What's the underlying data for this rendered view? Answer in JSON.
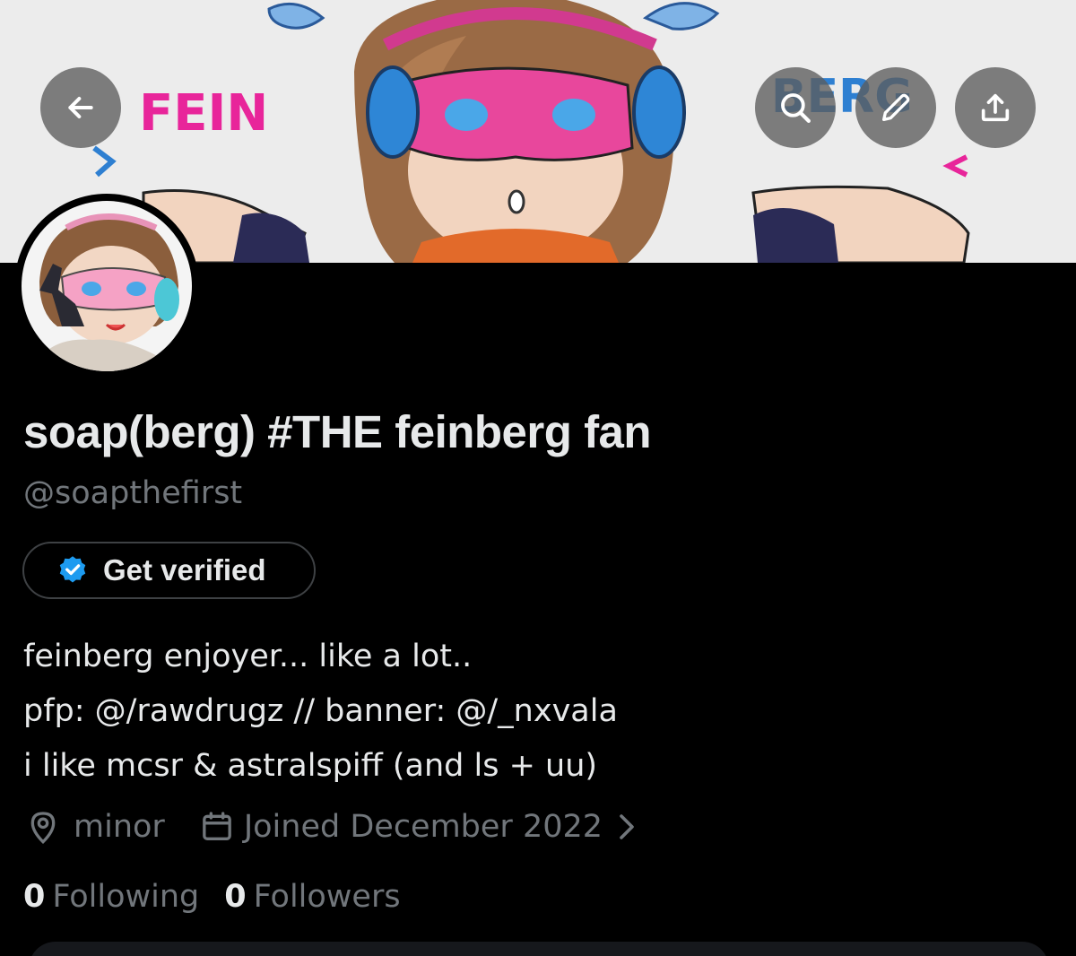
{
  "banner": {
    "description_icon": "banner-art",
    "art_text_left": "FEIN",
    "art_text_right": "BERG",
    "colors": {
      "pink": "#e8259a",
      "blue": "#2e7fd1",
      "brown": "#8b5a3c"
    }
  },
  "toolbar": {
    "back_icon": "arrow-left-icon",
    "search_icon": "search-icon",
    "edit_icon": "pencil-icon",
    "share_icon": "share-icon"
  },
  "profile": {
    "display_name": "soap(berg) #THE feinberg fan",
    "handle": "@soapthefirst",
    "verify_label": "Get verified",
    "bio": [
      "feinberg enjoyer... like a lot..",
      "pfp: @/rawdrugz // banner: @/_nxvala",
      "i like mcsr & astralspiff (and ls + uu)"
    ],
    "location": "minor",
    "joined": "Joined December 2022"
  },
  "stats": {
    "following_count": "0",
    "following_label": "Following",
    "followers_count": "0",
    "followers_label": "Followers"
  },
  "colors": {
    "background": "#000000",
    "text_primary": "#e7e9ea",
    "text_secondary": "#71767b",
    "verified_blue": "#1d9bf0",
    "button_border": "#3e4144"
  }
}
